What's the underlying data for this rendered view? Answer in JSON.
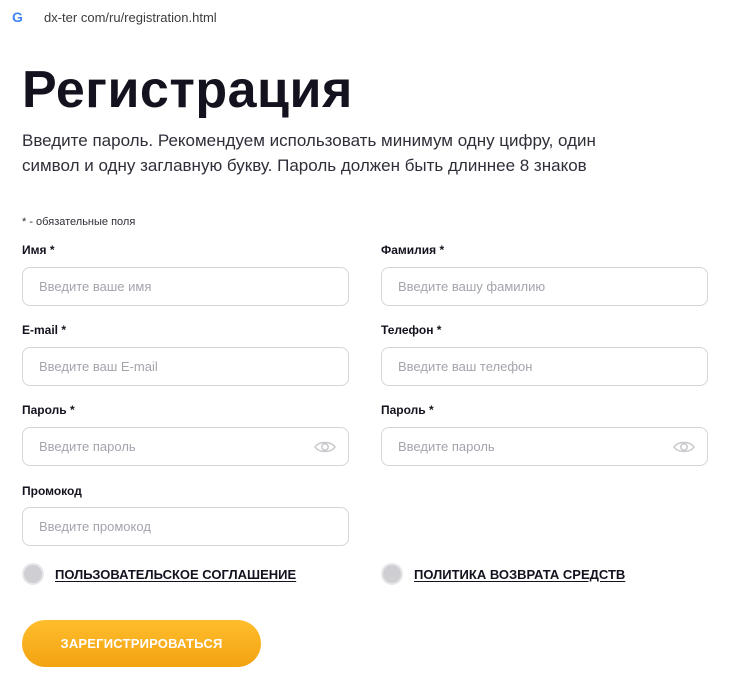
{
  "browser": {
    "url": "dx-ter com/ru/registration.html",
    "favicon_letter": "G"
  },
  "page": {
    "title": "Регистрация",
    "intro": "Введите пароль. Рекомендуем использовать минимум одну цифру, один символ и одну заглавную букву. Пароль должен быть длиннее 8 знаков",
    "required_note": "* - обязательные поля"
  },
  "form": {
    "first_name": {
      "label": "Имя *",
      "placeholder": "Введите ваше имя",
      "value": ""
    },
    "last_name": {
      "label": "Фамилия *",
      "placeholder": "Введите вашу фамилию",
      "value": ""
    },
    "email": {
      "label": "E-mail *",
      "placeholder": "Введите ваш E-mail",
      "value": ""
    },
    "phone": {
      "label": "Телефон *",
      "placeholder": "Введите ваш телефон",
      "value": ""
    },
    "password": {
      "label": "Пароль *",
      "placeholder": "Введите пароль",
      "value": ""
    },
    "password_confirm": {
      "label": "Пароль *",
      "placeholder": "Введите пароль",
      "value": ""
    },
    "promo": {
      "label": "Промокод",
      "placeholder": "Введите промокод",
      "value": ""
    },
    "agreement_label": "ПОЛЬЗОВАТЕЛЬСКОЕ СОГЛАШЕНИЕ",
    "refund_label": "ПОЛИТИКА ВОЗВРАТА СРЕДСТВ",
    "submit_label": "ЗАРЕГИСТРИРОВАТЬСЯ"
  },
  "colors": {
    "accent": "#f7ad1a",
    "text": "#14121e",
    "placeholder": "#a4a4ad",
    "border": "#d5d5da",
    "checkbox": "#cfcfd3"
  },
  "icons": {
    "favicon": "google-g-icon",
    "password_toggle": "eye-icon"
  }
}
